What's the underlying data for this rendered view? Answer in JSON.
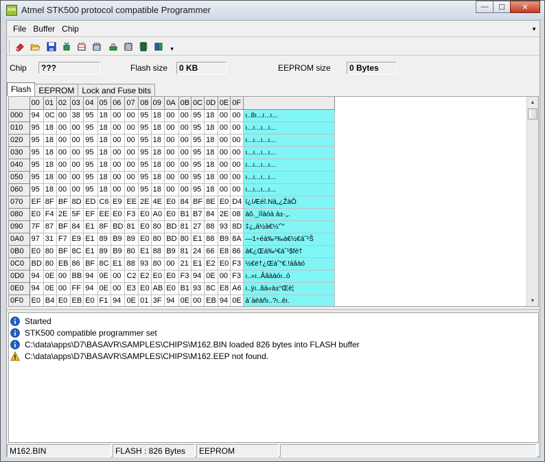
{
  "window": {
    "title": "Atmel STK500 protocol compatible Programmer",
    "icon": "app-icon",
    "minimize_glyph": "—",
    "maximize_glyph": "☐",
    "close_glyph": "✕"
  },
  "menu": {
    "items": [
      "File",
      "Buffer",
      "Chip"
    ],
    "chevron": "▼"
  },
  "toolbar": {
    "buttons": [
      "erase-icon",
      "open-icon",
      "save-icon",
      "read-icon",
      "program-icon",
      "verify-icon",
      "blank-check-icon",
      "read-fuses-icon",
      "chip-icon",
      "book-icon"
    ],
    "dropdown": "▾"
  },
  "info": {
    "chip_label": "Chip",
    "chip_value": "???",
    "flash_label": "Flash size",
    "flash_value": "0 KB",
    "eeprom_label": "EEPROM size",
    "eeprom_value": "0 Bytes"
  },
  "tabs": [
    "Flash",
    "EEPROM",
    "Lock and Fuse bits"
  ],
  "grid": {
    "columns": [
      "00",
      "01",
      "02",
      "03",
      "04",
      "05",
      "06",
      "07",
      "08",
      "09",
      "0A",
      "0B",
      "0C",
      "0D",
      "0E",
      "0F"
    ],
    "rows": [
      {
        "addr": "000",
        "bytes": [
          "94",
          "0C",
          "00",
          "38",
          "95",
          "18",
          "00",
          "00",
          "95",
          "18",
          "00",
          "00",
          "95",
          "18",
          "00",
          "00"
        ],
        "ascii": "ı..8ı...ı...ı..."
      },
      {
        "addr": "010",
        "bytes": [
          "95",
          "18",
          "00",
          "00",
          "95",
          "18",
          "00",
          "00",
          "95",
          "18",
          "00",
          "00",
          "95",
          "18",
          "00",
          "00"
        ],
        "ascii": "ı...ı...ı...ı..."
      },
      {
        "addr": "020",
        "bytes": [
          "95",
          "18",
          "00",
          "00",
          "95",
          "18",
          "00",
          "00",
          "95",
          "18",
          "00",
          "00",
          "95",
          "18",
          "00",
          "00"
        ],
        "ascii": "ı...ı...ı...ı..."
      },
      {
        "addr": "030",
        "bytes": [
          "95",
          "18",
          "00",
          "00",
          "95",
          "18",
          "00",
          "00",
          "95",
          "18",
          "00",
          "00",
          "95",
          "18",
          "00",
          "00"
        ],
        "ascii": "ı...ı...ı...ı..."
      },
      {
        "addr": "040",
        "bytes": [
          "95",
          "18",
          "00",
          "00",
          "95",
          "18",
          "00",
          "00",
          "95",
          "18",
          "00",
          "00",
          "95",
          "18",
          "00",
          "00"
        ],
        "ascii": "ı...ı...ı...ı..."
      },
      {
        "addr": "050",
        "bytes": [
          "95",
          "18",
          "00",
          "00",
          "95",
          "18",
          "00",
          "00",
          "95",
          "18",
          "00",
          "00",
          "95",
          "18",
          "00",
          "00"
        ],
        "ascii": "ı...ı...ı...ı..."
      },
      {
        "addr": "060",
        "bytes": [
          "95",
          "18",
          "00",
          "00",
          "95",
          "18",
          "00",
          "00",
          "95",
          "18",
          "00",
          "00",
          "95",
          "18",
          "00",
          "00"
        ],
        "ascii": "ı...ı...ı...ı..."
      },
      {
        "addr": "070",
        "bytes": [
          "EF",
          "8F",
          "BF",
          "8D",
          "ED",
          "C6",
          "E9",
          "EE",
          "2E",
          "4E",
          "E0",
          "84",
          "BF",
          "8E",
          "E0",
          "D4"
        ],
        "ascii": "ï¿íÆéî.Nà„¿ŽàÔ"
      },
      {
        "addr": "080",
        "bytes": [
          "E0",
          "F4",
          "2E",
          "5F",
          "EF",
          "EE",
          "E0",
          "F3",
          "E0",
          "A0",
          "E0",
          "B1",
          "B7",
          "84",
          "2E",
          "08"
        ],
        "ascii": "àô._ïîàóà à±·„."
      },
      {
        "addr": "090",
        "bytes": [
          "7F",
          "87",
          "BF",
          "84",
          "E1",
          "8F",
          "BD",
          "81",
          "E0",
          "80",
          "BD",
          "81",
          "27",
          "88",
          "93",
          "8D"
        ],
        "ascii": "‡¿„á½à€½'ˆ“"
      },
      {
        "addr": "0A0",
        "bytes": [
          "97",
          "31",
          "F7",
          "E9",
          "E1",
          "89",
          "B9",
          "89",
          "E0",
          "80",
          "BD",
          "80",
          "E1",
          "88",
          "B9",
          "8A"
        ],
        "ascii": "—1÷éá‰¹‰à€½€áˆ¹Š"
      },
      {
        "addr": "0B0",
        "bytes": [
          "E0",
          "80",
          "BF",
          "8C",
          "E1",
          "89",
          "B9",
          "80",
          "E1",
          "88",
          "B9",
          "81",
          "24",
          "66",
          "E8",
          "86"
        ],
        "ascii": "à€¿Œá‰¹€áˆ¹$fè†"
      },
      {
        "addr": "0C0",
        "bytes": [
          "BD",
          "80",
          "EB",
          "86",
          "BF",
          "8C",
          "E1",
          "88",
          "93",
          "80",
          "00",
          "21",
          "E1",
          "E2",
          "E0",
          "F3"
        ],
        "ascii": "½€ë†¿Œáˆ“€.!áâàó"
      },
      {
        "addr": "0D0",
        "bytes": [
          "94",
          "0E",
          "00",
          "BB",
          "94",
          "0E",
          "00",
          "C2",
          "E2",
          "E0",
          "E0",
          "F3",
          "94",
          "0E",
          "00",
          "F3"
        ],
        "ascii": "ı..»ı..Ââààóı..ó"
      },
      {
        "addr": "0E0",
        "bytes": [
          "94",
          "0E",
          "00",
          "FF",
          "94",
          "0E",
          "00",
          "E3",
          "E0",
          "AB",
          "E0",
          "B1",
          "93",
          "8C",
          "E8",
          "A6"
        ],
        "ascii": "ı..ÿı..ãà«à±“Œè¦"
      },
      {
        "addr": "0F0",
        "bytes": [
          "E0",
          "B4",
          "E0",
          "EB",
          "E0",
          "F1",
          "94",
          "0E",
          "01",
          "3F",
          "94",
          "0E",
          "00",
          "EB",
          "94",
          "0E"
        ],
        "ascii": "à´àëàñı..?ı..ëı."
      }
    ]
  },
  "log": [
    {
      "icon": "info-icon",
      "text": "Started"
    },
    {
      "icon": "info-icon",
      "text": "STK500 compatible programmer set"
    },
    {
      "icon": "info-icon",
      "text": "C:\\data\\apps\\D7\\BASAVR\\SAMPLES\\CHIPS\\M162.BIN loaded 826 bytes into FLASH buffer"
    },
    {
      "icon": "warning-icon",
      "text": "C:\\data\\apps\\D7\\BASAVR\\SAMPLES\\CHIPS\\M162.EEP not found."
    }
  ],
  "status": {
    "file": "M162.BIN",
    "flash": "FLASH : 826 Bytes",
    "eeprom": "EEPROM",
    "extra": ""
  },
  "colors": {
    "ascii_bg": "#7ff5f6",
    "info_blue": "#1f63c8",
    "warning_yellow": "#f3c623"
  }
}
